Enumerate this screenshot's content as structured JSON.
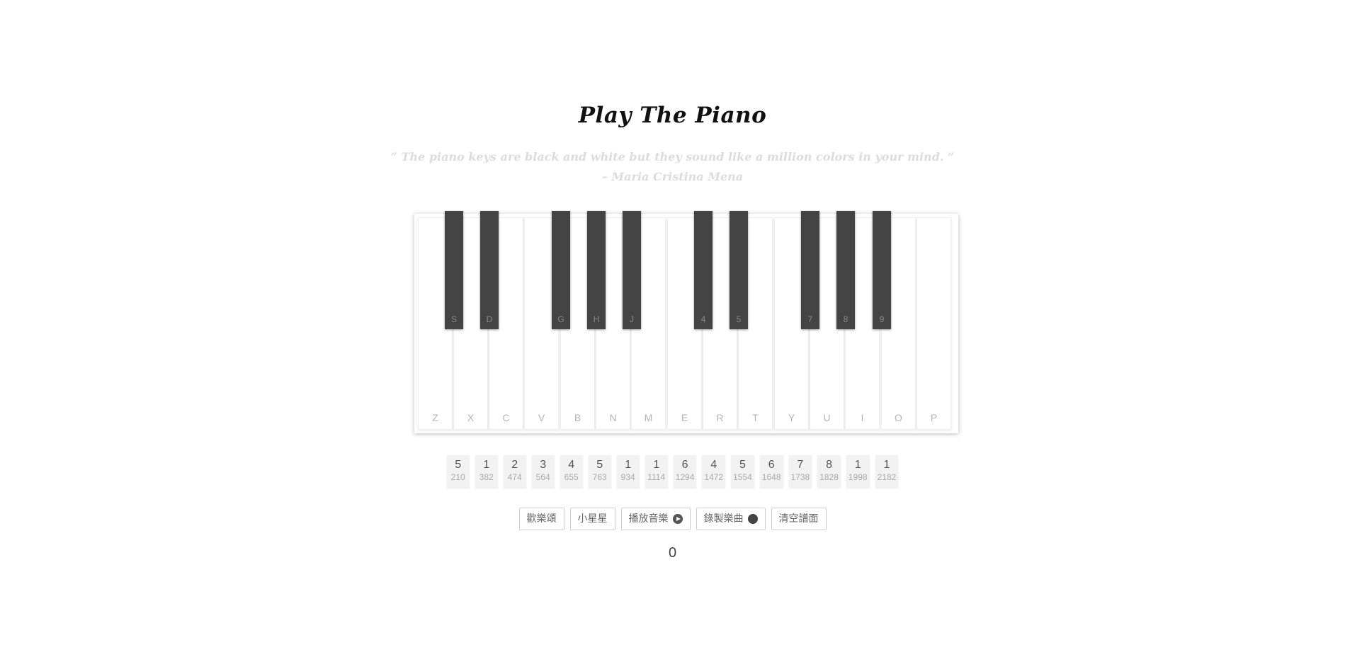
{
  "header": {
    "title": "Play The Piano",
    "quote_line1": "“ The piano keys are black and white but they sound like a million colors in your mind. ”",
    "quote_line2": "– Maria Cristina Mena"
  },
  "piano": {
    "white_keys": [
      "Z",
      "X",
      "C",
      "V",
      "B",
      "N",
      "M",
      "E",
      "R",
      "T",
      "Y",
      "U",
      "I",
      "O",
      "P"
    ],
    "black_keys": [
      "S",
      "D",
      "G",
      "H",
      "J",
      "4",
      "5",
      "7",
      "8",
      "9"
    ]
  },
  "recorded_notes": [
    {
      "note": "5",
      "time": "210"
    },
    {
      "note": "1",
      "time": "382"
    },
    {
      "note": "2",
      "time": "474"
    },
    {
      "note": "3",
      "time": "564"
    },
    {
      "note": "4",
      "time": "655"
    },
    {
      "note": "5",
      "time": "763"
    },
    {
      "note": "1",
      "time": "934"
    },
    {
      "note": "1",
      "time": "1114"
    },
    {
      "note": "6",
      "time": "1294"
    },
    {
      "note": "4",
      "time": "1472"
    },
    {
      "note": "5",
      "time": "1554"
    },
    {
      "note": "6",
      "time": "1648"
    },
    {
      "note": "7",
      "time": "1738"
    },
    {
      "note": "8",
      "time": "1828"
    },
    {
      "note": "1",
      "time": "1998"
    },
    {
      "note": "1",
      "time": "2182"
    }
  ],
  "controls": {
    "ode_to_joy": "歡樂頌",
    "twinkle_star": "小星星",
    "play_music": "播放音樂",
    "record_music": "錄製樂曲",
    "clear_score": "清空譜面",
    "play_icon": "play-circle-icon",
    "record_icon": "record-dot-icon"
  },
  "counter": {
    "value": "0"
  },
  "colors": {
    "black_key": "#444444",
    "quote_text": "#dcdcdc",
    "title_text": "#111111"
  }
}
